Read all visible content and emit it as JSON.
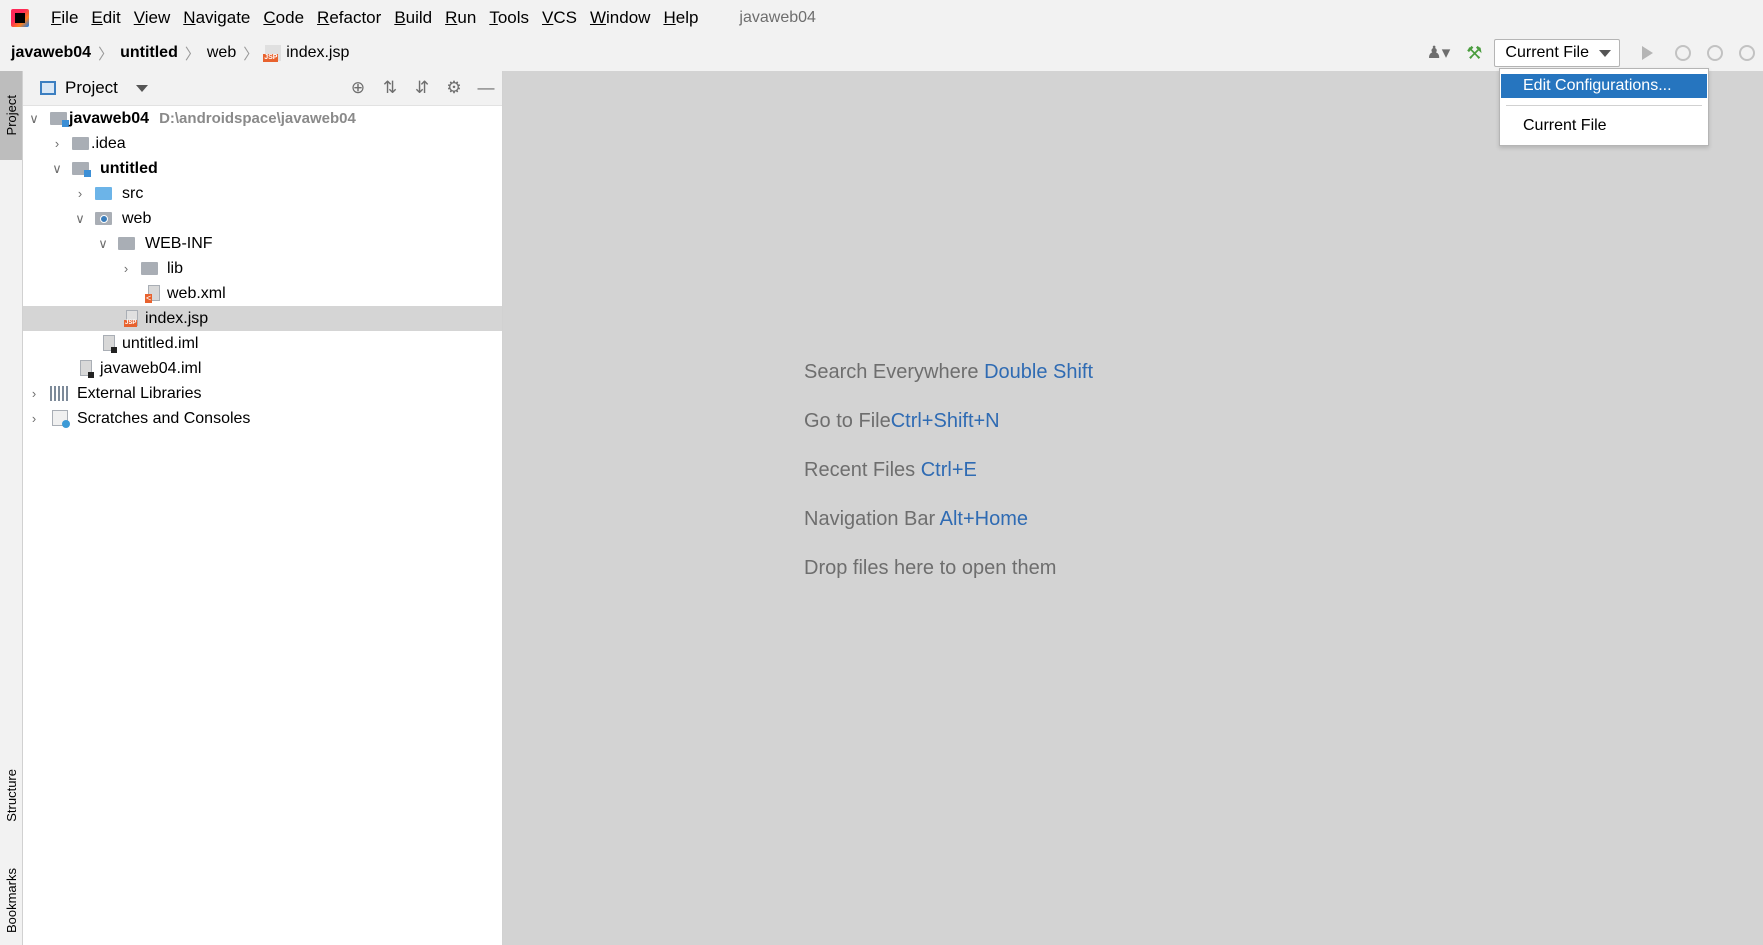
{
  "menubar": {
    "items": [
      "File",
      "Edit",
      "View",
      "Navigate",
      "Code",
      "Refactor",
      "Build",
      "Run",
      "Tools",
      "VCS",
      "Window",
      "Help"
    ],
    "window_title": "javaweb04"
  },
  "navbar": {
    "crumbs": [
      "javaweb04",
      "untitled",
      "web",
      "index.jsp"
    ],
    "run_config": "Current File"
  },
  "left_strip": {
    "project_tab": "Project",
    "structure_tab": "Structure",
    "bookmarks_tab": "Bookmarks"
  },
  "project_panel": {
    "title": "Project",
    "tree": [
      {
        "label": "javaweb04",
        "path": "D:\\androidspace\\javaweb04"
      },
      {
        "label": ".idea"
      },
      {
        "label": "untitled"
      },
      {
        "label": "src"
      },
      {
        "label": "web"
      },
      {
        "label": "WEB-INF"
      },
      {
        "label": "lib"
      },
      {
        "label": "web.xml"
      },
      {
        "label": "index.jsp"
      },
      {
        "label": "untitled.iml"
      },
      {
        "label": "javaweb04.iml"
      },
      {
        "label": "External Libraries"
      },
      {
        "label": "Scratches and Consoles"
      }
    ]
  },
  "editor": {
    "hints": [
      {
        "text": "Search Everywhere",
        "key": "Double Shift"
      },
      {
        "text": "Go to File",
        "key": "Ctrl+Shift+N"
      },
      {
        "text": "Recent Files",
        "key": "Ctrl+E"
      },
      {
        "text": "Navigation Bar",
        "key": "Alt+Home"
      },
      {
        "text": "Drop files here to open them",
        "key": ""
      }
    ]
  },
  "dropdown": {
    "items": [
      "Edit Configurations...",
      "Current File"
    ]
  },
  "colors": {
    "accent": "#2675bf",
    "hint_key": "#2f6bb3",
    "editor_bg": "#d3d3d3",
    "selection": "#d5d5d5"
  }
}
